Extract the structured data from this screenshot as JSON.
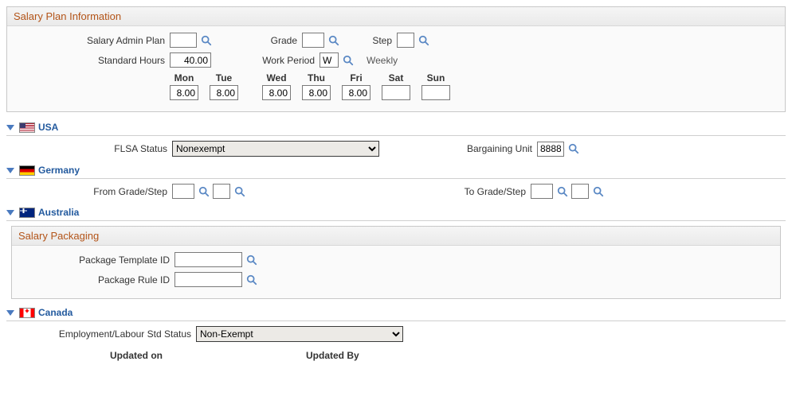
{
  "salary_plan": {
    "title": "Salary Plan Information",
    "labels": {
      "salary_admin_plan": "Salary Admin Plan",
      "grade": "Grade",
      "step": "Step",
      "standard_hours": "Standard Hours",
      "work_period": "Work Period"
    },
    "values": {
      "salary_admin_plan": "",
      "grade": "",
      "step": "",
      "standard_hours": "40.00",
      "work_period": "W",
      "work_period_descr": "Weekly"
    },
    "days": {
      "headers": [
        "Mon",
        "Tue",
        "Wed",
        "Thu",
        "Fri",
        "Sat",
        "Sun"
      ],
      "values": [
        "8.00",
        "8.00",
        "8.00",
        "8.00",
        "8.00",
        "",
        ""
      ]
    }
  },
  "usa": {
    "title": "USA",
    "labels": {
      "flsa_status": "FLSA Status",
      "bargaining_unit": "Bargaining Unit"
    },
    "values": {
      "flsa_status": "Nonexempt",
      "bargaining_unit": "8888"
    }
  },
  "germany": {
    "title": "Germany",
    "labels": {
      "from_grade_step": "From Grade/Step",
      "to_grade_step": "To Grade/Step"
    },
    "values": {
      "from_grade": "",
      "from_step": "",
      "to_grade": "",
      "to_step": ""
    }
  },
  "australia": {
    "title": "Australia",
    "packaging": {
      "title": "Salary Packaging",
      "labels": {
        "template_id": "Package Template ID",
        "rule_id": "Package Rule ID"
      },
      "values": {
        "template_id": "",
        "rule_id": ""
      }
    }
  },
  "canada": {
    "title": "Canada",
    "labels": {
      "emp_labour_std_status": "Employment/Labour Std Status"
    },
    "values": {
      "emp_labour_std_status": "Non-Exempt"
    }
  },
  "footer": {
    "updated_on_label": "Updated on",
    "updated_by_label": "Updated By"
  }
}
